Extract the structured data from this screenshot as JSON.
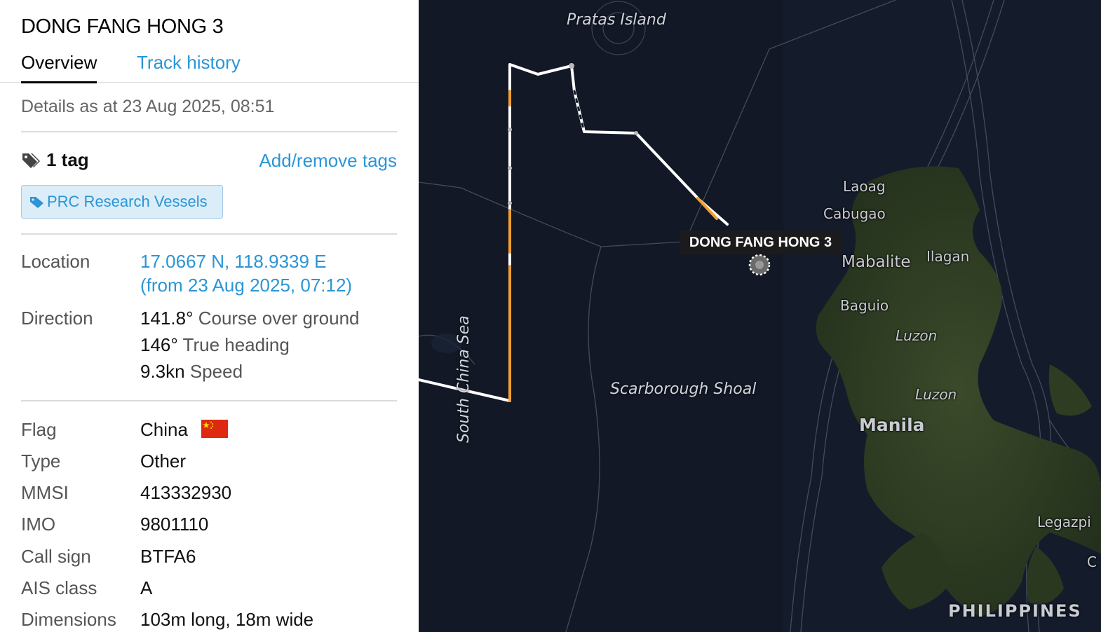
{
  "vessel": {
    "name": "DONG FANG HONG 3"
  },
  "tabs": {
    "overview": "Overview",
    "track_history": "Track history"
  },
  "details_as_at": "Details as at 23 Aug 2025, 08:51",
  "tags": {
    "count_label": "1 tag",
    "add_remove_label": "Add/remove tags",
    "items": [
      "PRC Research Vessels"
    ]
  },
  "location": {
    "label": "Location",
    "coords": "17.0667 N, 118.9339 E",
    "since": "(from 23 Aug 2025, 07:12)"
  },
  "direction": {
    "label": "Direction",
    "course_value": "141.8°",
    "course_label": "Course over ground",
    "heading_value": "146°",
    "heading_label": "True heading",
    "speed_value": "9.3kn",
    "speed_label": "Speed"
  },
  "particulars": {
    "flag_label": "Flag",
    "flag_value": "China",
    "type_label": "Type",
    "type_value": "Other",
    "mmsi_label": "MMSI",
    "mmsi_value": "413332930",
    "imo_label": "IMO",
    "imo_value": "9801110",
    "callsign_label": "Call sign",
    "callsign_value": "BTFA6",
    "ais_label": "AIS class",
    "ais_value": "A",
    "dimensions_label": "Dimensions",
    "dimensions_value": "103m long, 18m wide"
  },
  "map": {
    "labels": {
      "pratas": "Pratas Island",
      "south_china_sea": "South China Sea",
      "scarborough": "Scarborough Shoal",
      "laoag": "Laoag",
      "cabugao": "Cabugao",
      "mabalite": "Mabalite",
      "ilagan": "Ilagan",
      "baguio": "Baguio",
      "luzon_1": "Luzon",
      "luzon_2": "Luzon",
      "manila": "Manila",
      "legazpi": "Legazpi",
      "c": "C",
      "philippines": "PHILIPPINES"
    },
    "vessel_label": "DONG FANG HONG 3",
    "colors": {
      "sea": "#121826",
      "land": "#2c3a22",
      "track": "#ffffff",
      "track_highlight": "#f0a030"
    }
  },
  "icons": {
    "tag": "tag-icon",
    "chip_tag": "tag-icon",
    "flag": "china-flag-icon",
    "vessel": "vessel-marker-icon"
  }
}
